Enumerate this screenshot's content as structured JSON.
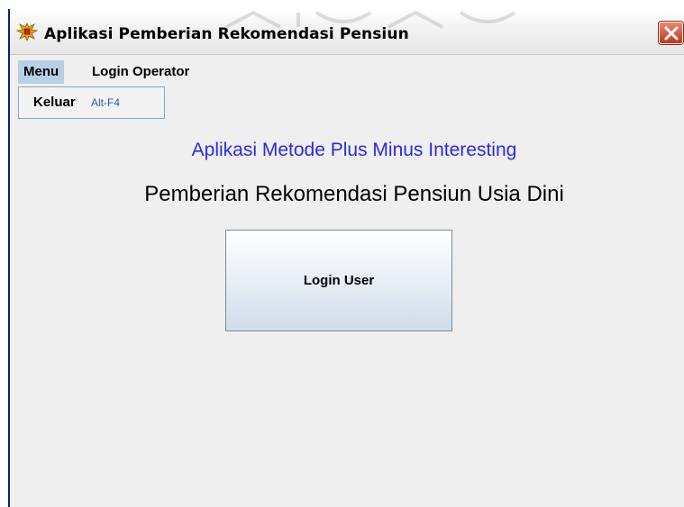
{
  "window": {
    "title": "Aplikasi Pemberian Rekomendasi Pensiun",
    "close_icon": "close-icon"
  },
  "menubar": {
    "items": [
      {
        "label": "Menu",
        "active": true
      },
      {
        "label": "Login Operator",
        "active": false
      }
    ]
  },
  "dropdown": {
    "items": [
      {
        "label": "Keluar",
        "accelerator": "Alt-F4"
      }
    ]
  },
  "main": {
    "heading_primary": "Aplikasi Metode Plus Minus Interesting",
    "heading_secondary": "Pemberian Rekomendasi Pensiun Usia Dini",
    "login_button": "Login User"
  },
  "colors": {
    "accent_heading": "#2b2bdc",
    "menu_highlight": "#b8cfe5",
    "close_button": "#c3361a"
  }
}
